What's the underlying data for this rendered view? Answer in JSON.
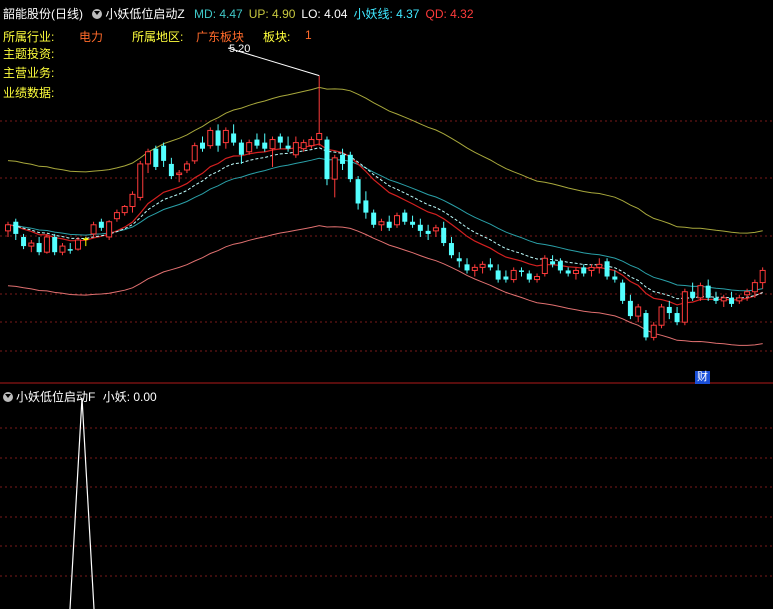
{
  "main": {
    "stock_name": "韶能股份(日线)",
    "indicator_name": "小妖低位启动Z",
    "values": [
      {
        "label": "MD:",
        "value": "4.47",
        "color": "#3fc8c8"
      },
      {
        "label": "UP:",
        "value": "4.90",
        "color": "#c8c83f"
      },
      {
        "label": "LO:",
        "value": "4.04",
        "color": "#ffffff"
      },
      {
        "label": "小妖线:",
        "value": "4.37",
        "color": "#3fe8ff"
      },
      {
        "label": "QD:",
        "value": "4.32",
        "color": "#ff3b3b"
      }
    ],
    "info": {
      "industry_label": "所属行业:",
      "industry_value": "电力",
      "region_label": "所属地区:",
      "region_value": "广东板块",
      "sector_label": "板块:",
      "sector_value": "1",
      "theme_label": "主题投资:",
      "business_label": "主营业务:",
      "performance_label": "业绩数据:"
    },
    "high_price_label": "5.20",
    "finance_badge": "财"
  },
  "sub": {
    "indicator_name": "小妖低位启动F",
    "value_label": "小妖:",
    "value": "0.00"
  },
  "colors": {
    "up": "#ff3b3b",
    "down": "#54ffff",
    "upper_band": "#a8a83c",
    "lower_band": "#e07070",
    "md_line": "#2aa0a8",
    "qd_line": "#d42020",
    "dashed_line": "#c0ffff",
    "signal": "#ffff00",
    "grid": "#7a1a1a"
  },
  "candles": [
    [
      4.18,
      4.24,
      4.14,
      4.22
    ],
    [
      4.24,
      4.26,
      4.12,
      4.16
    ],
    [
      4.14,
      4.16,
      4.06,
      4.08
    ],
    [
      4.08,
      4.12,
      4.04,
      4.1
    ],
    [
      4.1,
      4.14,
      4.02,
      4.04
    ],
    [
      4.04,
      4.16,
      4.03,
      4.14
    ],
    [
      4.14,
      4.16,
      4.02,
      4.04
    ],
    [
      4.04,
      4.1,
      4.02,
      4.08
    ],
    [
      4.06,
      4.1,
      4.03,
      4.05
    ],
    [
      4.06,
      4.14,
      4.05,
      4.12
    ],
    [
      4.12,
      4.14,
      4.08,
      4.13
    ],
    [
      4.16,
      4.24,
      4.14,
      4.22
    ],
    [
      4.24,
      4.26,
      4.18,
      4.2
    ],
    [
      4.14,
      4.25,
      4.12,
      4.24
    ],
    [
      4.26,
      4.32,
      4.24,
      4.3
    ],
    [
      4.3,
      4.35,
      4.28,
      4.34
    ],
    [
      4.34,
      4.44,
      4.3,
      4.42
    ],
    [
      4.4,
      4.64,
      4.38,
      4.62
    ],
    [
      4.62,
      4.72,
      4.56,
      4.7
    ],
    [
      4.72,
      4.74,
      4.58,
      4.6
    ],
    [
      4.74,
      4.76,
      4.6,
      4.64
    ],
    [
      4.62,
      4.66,
      4.52,
      4.54
    ],
    [
      4.55,
      4.58,
      4.5,
      4.56
    ],
    [
      4.58,
      4.64,
      4.56,
      4.62
    ],
    [
      4.64,
      4.76,
      4.62,
      4.74
    ],
    [
      4.76,
      4.8,
      4.7,
      4.72
    ],
    [
      4.74,
      4.86,
      4.72,
      4.84
    ],
    [
      4.84,
      4.88,
      4.7,
      4.74
    ],
    [
      4.76,
      4.86,
      4.72,
      4.84
    ],
    [
      4.82,
      4.88,
      4.74,
      4.76
    ],
    [
      4.76,
      4.78,
      4.62,
      4.68
    ],
    [
      4.7,
      4.78,
      4.68,
      4.76
    ],
    [
      4.78,
      4.82,
      4.72,
      4.74
    ],
    [
      4.76,
      4.82,
      4.7,
      4.72
    ],
    [
      4.72,
      4.8,
      4.6,
      4.78
    ],
    [
      4.8,
      4.82,
      4.72,
      4.76
    ],
    [
      4.74,
      4.8,
      4.7,
      4.72
    ],
    [
      4.68,
      4.8,
      4.66,
      4.76
    ],
    [
      4.72,
      4.78,
      4.7,
      4.76
    ],
    [
      4.74,
      4.8,
      4.72,
      4.78
    ],
    [
      4.78,
      5.2,
      4.74,
      4.82
    ],
    [
      4.78,
      4.8,
      4.48,
      4.52
    ],
    [
      4.52,
      4.68,
      4.4,
      4.66
    ],
    [
      4.68,
      4.72,
      4.58,
      4.62
    ],
    [
      4.68,
      4.7,
      4.5,
      4.52
    ],
    [
      4.52,
      4.54,
      4.32,
      4.36
    ],
    [
      4.38,
      4.44,
      4.26,
      4.3
    ],
    [
      4.3,
      4.32,
      4.2,
      4.22
    ],
    [
      4.22,
      4.26,
      4.18,
      4.24
    ],
    [
      4.24,
      4.28,
      4.18,
      4.2
    ],
    [
      4.22,
      4.3,
      4.2,
      4.28
    ],
    [
      4.3,
      4.32,
      4.22,
      4.24
    ],
    [
      4.24,
      4.28,
      4.2,
      4.22
    ],
    [
      4.22,
      4.26,
      4.14,
      4.18
    ],
    [
      4.18,
      4.22,
      4.12,
      4.16
    ],
    [
      4.18,
      4.22,
      4.14,
      4.2
    ],
    [
      4.2,
      4.24,
      4.08,
      4.1
    ],
    [
      4.1,
      4.14,
      4.0,
      4.02
    ],
    [
      4.0,
      4.04,
      3.94,
      3.98
    ],
    [
      3.96,
      4.0,
      3.9,
      3.92
    ],
    [
      3.92,
      3.96,
      3.88,
      3.94
    ],
    [
      3.94,
      3.98,
      3.9,
      3.96
    ],
    [
      3.96,
      4.0,
      3.92,
      3.94
    ],
    [
      3.92,
      3.96,
      3.84,
      3.86
    ],
    [
      3.88,
      3.92,
      3.84,
      3.86
    ],
    [
      3.86,
      3.94,
      3.84,
      3.92
    ],
    [
      3.92,
      3.94,
      3.88,
      3.91
    ],
    [
      3.9,
      3.92,
      3.84,
      3.86
    ],
    [
      3.86,
      3.9,
      3.84,
      3.88
    ],
    [
      3.9,
      4.02,
      3.88,
      4.0
    ],
    [
      3.98,
      4.02,
      3.94,
      3.96
    ],
    [
      3.98,
      4.0,
      3.9,
      3.92
    ],
    [
      3.92,
      3.94,
      3.88,
      3.9
    ],
    [
      3.9,
      3.94,
      3.86,
      3.92
    ],
    [
      3.94,
      3.96,
      3.88,
      3.9
    ],
    [
      3.92,
      3.96,
      3.88,
      3.94
    ],
    [
      3.94,
      4.0,
      3.9,
      3.96
    ],
    [
      3.98,
      4.0,
      3.86,
      3.88
    ],
    [
      3.88,
      3.92,
      3.84,
      3.86
    ],
    [
      3.84,
      3.86,
      3.7,
      3.72
    ],
    [
      3.72,
      3.76,
      3.6,
      3.62
    ],
    [
      3.62,
      3.7,
      3.58,
      3.68
    ],
    [
      3.64,
      3.66,
      3.46,
      3.48
    ],
    [
      3.48,
      3.58,
      3.46,
      3.56
    ],
    [
      3.56,
      3.7,
      3.54,
      3.68
    ],
    [
      3.68,
      3.72,
      3.6,
      3.64
    ],
    [
      3.64,
      3.68,
      3.56,
      3.58
    ],
    [
      3.58,
      3.8,
      3.56,
      3.78
    ],
    [
      3.78,
      3.84,
      3.72,
      3.74
    ],
    [
      3.74,
      3.84,
      3.72,
      3.82
    ],
    [
      3.82,
      3.86,
      3.72,
      3.74
    ],
    [
      3.74,
      3.78,
      3.7,
      3.72
    ],
    [
      3.72,
      3.76,
      3.68,
      3.74
    ],
    [
      3.74,
      3.78,
      3.68,
      3.7
    ],
    [
      3.72,
      3.76,
      3.7,
      3.74
    ],
    [
      3.76,
      3.8,
      3.72,
      3.78
    ],
    [
      3.78,
      3.86,
      3.74,
      3.84
    ],
    [
      3.84,
      3.94,
      3.8,
      3.92
    ]
  ]
}
